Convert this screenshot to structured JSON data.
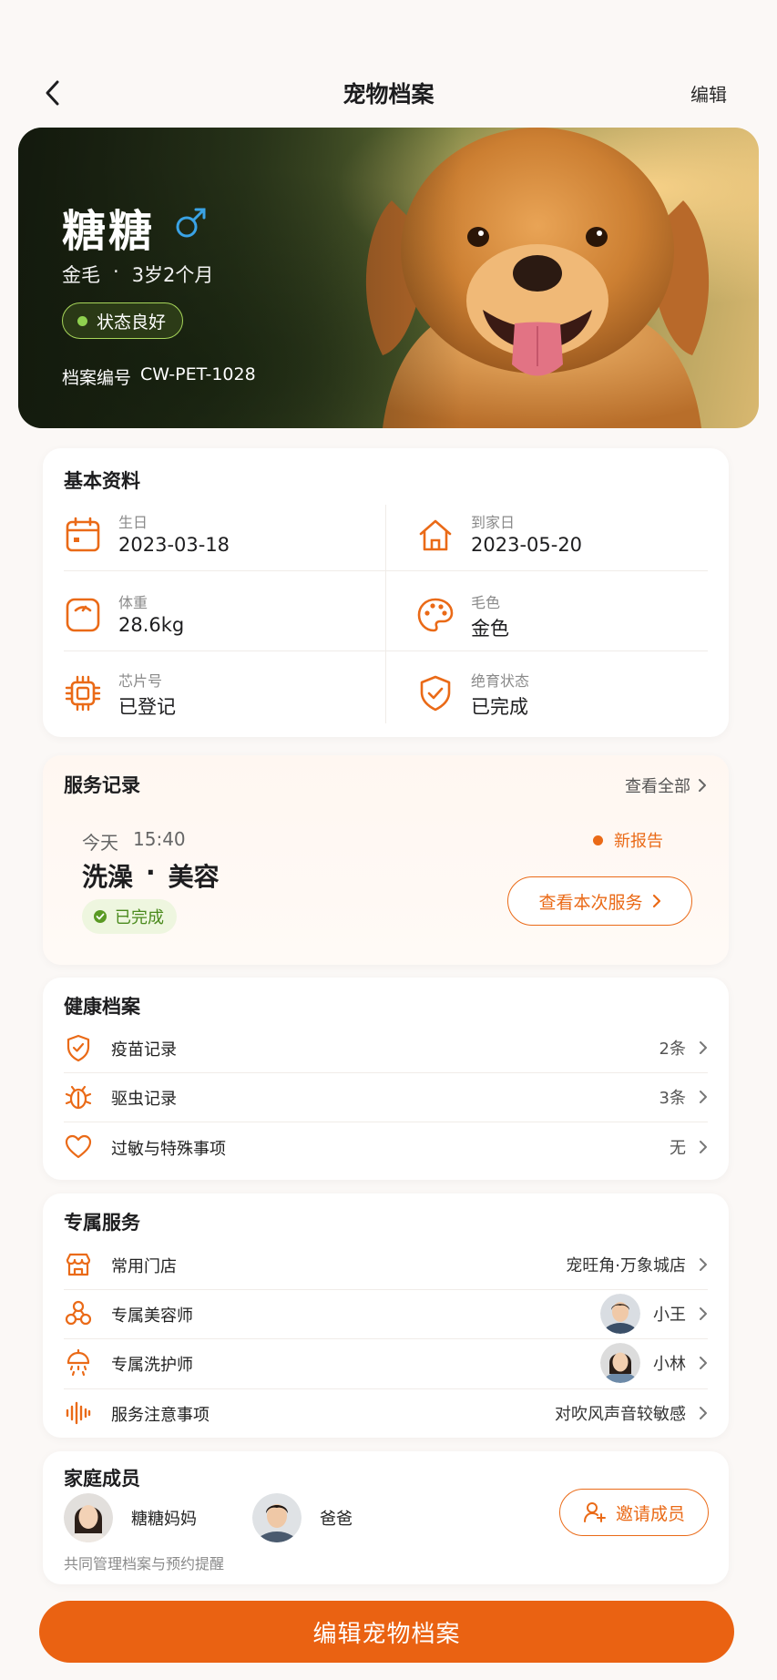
{
  "header": {
    "title": "宠物档案",
    "edit_label": "编辑"
  },
  "pet": {
    "name": "糖糖",
    "gender_icon": "male-icon",
    "breed": "金毛",
    "separator": "·",
    "age": "3岁2个月",
    "status": "状态良好",
    "record_label": "档案编号",
    "record_no": "CW-PET-1028"
  },
  "basic_info": {
    "title": "基本资料",
    "items": [
      {
        "label": "生日",
        "value": "2023-03-18",
        "icon": "calendar-icon"
      },
      {
        "label": "到家日",
        "value": "2023-05-20",
        "icon": "home-icon"
      },
      {
        "label": "体重",
        "value": "28.6kg",
        "icon": "scale-icon"
      },
      {
        "label": "毛色",
        "value": "金色",
        "icon": "palette-icon"
      },
      {
        "label": "芯片号",
        "value": "已登记",
        "icon": "chip-icon"
      },
      {
        "label": "绝育状态",
        "value": "已完成",
        "icon": "shield-check-icon"
      }
    ]
  },
  "service_record": {
    "title": "服务记录",
    "view_all": "查看全部",
    "day": "今天",
    "time": "15:40",
    "service_a": "洗澡",
    "service_sep": "·",
    "service_b": "美容",
    "status": "已完成",
    "new_report": "新报告",
    "view_button": "查看本次服务"
  },
  "health": {
    "title": "健康档案",
    "items": [
      {
        "label": "疫苗记录",
        "value": "2条",
        "icon": "shield-check-icon"
      },
      {
        "label": "驱虫记录",
        "value": "3条",
        "icon": "bug-icon"
      },
      {
        "label": "过敏与特殊事项",
        "value": "无",
        "icon": "heart-icon"
      }
    ]
  },
  "exclusive": {
    "title": "专属服务",
    "items": [
      {
        "label": "常用门店",
        "value": "宠旺角·万象城店",
        "icon": "store-icon"
      },
      {
        "label": "专属美容师",
        "value": "小王",
        "icon": "grooming-icon"
      },
      {
        "label": "专属洗护师",
        "value": "小林",
        "icon": "shower-icon"
      },
      {
        "label": "服务注意事项",
        "value": "对吹风声音较敏感",
        "icon": "sound-wave-icon"
      }
    ]
  },
  "family": {
    "title": "家庭成员",
    "members": [
      {
        "name": "糖糖妈妈"
      },
      {
        "name": "爸爸"
      }
    ],
    "note": "共同管理档案与预约提醒",
    "invite_label": "邀请成员"
  },
  "cta": {
    "label": "编辑宠物档案"
  },
  "colors": {
    "accent": "#EA6212",
    "success": "#4A8A1C",
    "status_green": "#8FD14F"
  }
}
